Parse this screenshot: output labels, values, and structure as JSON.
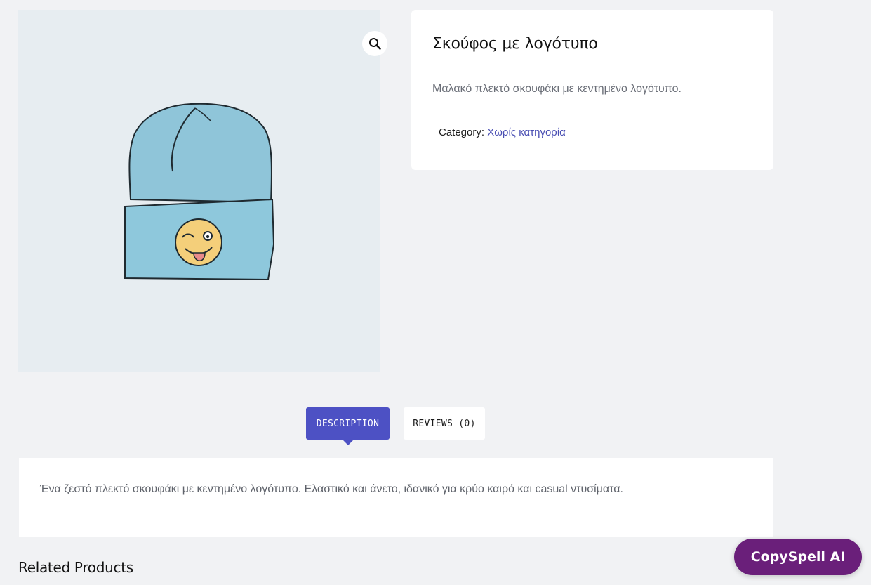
{
  "product": {
    "title": "Σκούφος με λογότυπο",
    "short_description": "Μαλακό πλεκτό σκουφάκι με κεντημένο λογότυπο.",
    "category_label": "Category:",
    "category_value": "Χωρίς κατηγορία",
    "image": {
      "subject": "light blue knit beanie with winking emoji patch"
    }
  },
  "tabs": [
    {
      "label": "DESCRIPTION",
      "active": true
    },
    {
      "label": "REVIEWS (0)",
      "active": false
    }
  ],
  "description_text": "Ένα ζεστό πλεκτό σκουφάκι με κεντημένο λογότυπο. Ελαστικό και άνετο, ιδανικό για κρύο καιρό και casual ντυσίματα.",
  "related_heading": "Related Products",
  "widget": {
    "label": "CopySpell AI"
  },
  "icons": {
    "zoom": "magnifier-icon"
  },
  "colors": {
    "accent": "#4d51c4",
    "link": "#4a4fb3",
    "widget": "#6a1f7a",
    "hat": "#8fc5d9",
    "background": "#f1f2f4"
  }
}
